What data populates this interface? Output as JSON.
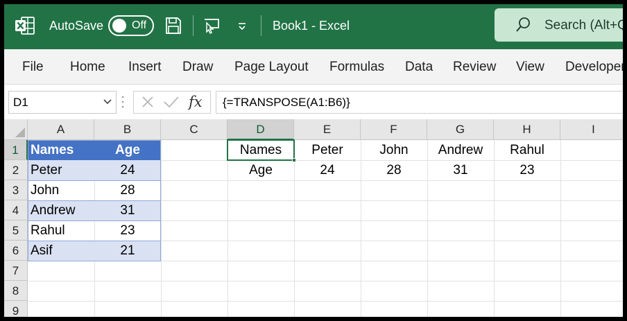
{
  "titlebar": {
    "autosave_label": "AutoSave",
    "autosave_state": "Off",
    "document_title": "Book1  -  Excel",
    "search_placeholder": "Search (Alt+Q)",
    "accent": "#217346"
  },
  "ribbon": {
    "tabs": [
      "File",
      "Home",
      "Insert",
      "Draw",
      "Page Layout",
      "Formulas",
      "Data",
      "Review",
      "View",
      "Developer"
    ]
  },
  "formula_bar": {
    "name_box": "D1",
    "formula": "{=TRANSPOSE(A1:B6)}",
    "fx_label": "fx"
  },
  "grid": {
    "columns": [
      "A",
      "B",
      "C",
      "D",
      "E",
      "F",
      "G",
      "H",
      "I"
    ],
    "rows": [
      "1",
      "2",
      "3",
      "4",
      "5",
      "6",
      "7",
      "8",
      "9"
    ],
    "selected_cell": "D1",
    "table": {
      "headers": [
        "Names",
        "Age"
      ],
      "rows": [
        [
          "Peter",
          "24"
        ],
        [
          "John",
          "28"
        ],
        [
          "Andrew",
          "31"
        ],
        [
          "Rahul",
          "23"
        ],
        [
          "Asif",
          "21"
        ]
      ],
      "header_color": "#4472C4",
      "band_color": "#D9E1F2"
    },
    "transposed": {
      "row1": [
        "Names",
        "Peter",
        "John",
        "Andrew",
        "Rahul"
      ],
      "row2": [
        "Age",
        "24",
        "28",
        "31",
        "23"
      ]
    }
  }
}
